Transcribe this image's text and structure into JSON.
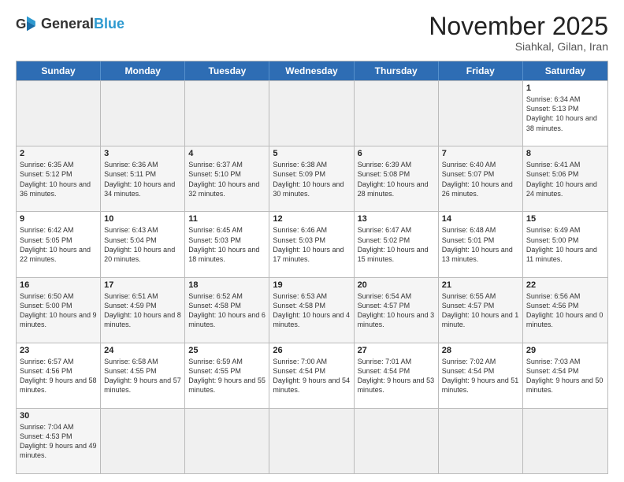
{
  "header": {
    "logo_general": "General",
    "logo_blue": "Blue",
    "month_title": "November 2025",
    "subtitle": "Siahkal, Gilan, Iran"
  },
  "days_of_week": [
    "Sunday",
    "Monday",
    "Tuesday",
    "Wednesday",
    "Thursday",
    "Friday",
    "Saturday"
  ],
  "weeks": [
    [
      {
        "day": "",
        "text": "",
        "empty": true
      },
      {
        "day": "",
        "text": "",
        "empty": true
      },
      {
        "day": "",
        "text": "",
        "empty": true
      },
      {
        "day": "",
        "text": "",
        "empty": true
      },
      {
        "day": "",
        "text": "",
        "empty": true
      },
      {
        "day": "",
        "text": "",
        "empty": true
      },
      {
        "day": "1",
        "text": "Sunrise: 6:34 AM\nSunset: 5:13 PM\nDaylight: 10 hours and 38 minutes."
      }
    ],
    [
      {
        "day": "2",
        "text": "Sunrise: 6:35 AM\nSunset: 5:12 PM\nDaylight: 10 hours and 36 minutes."
      },
      {
        "day": "3",
        "text": "Sunrise: 6:36 AM\nSunset: 5:11 PM\nDaylight: 10 hours and 34 minutes."
      },
      {
        "day": "4",
        "text": "Sunrise: 6:37 AM\nSunset: 5:10 PM\nDaylight: 10 hours and 32 minutes."
      },
      {
        "day": "5",
        "text": "Sunrise: 6:38 AM\nSunset: 5:09 PM\nDaylight: 10 hours and 30 minutes."
      },
      {
        "day": "6",
        "text": "Sunrise: 6:39 AM\nSunset: 5:08 PM\nDaylight: 10 hours and 28 minutes."
      },
      {
        "day": "7",
        "text": "Sunrise: 6:40 AM\nSunset: 5:07 PM\nDaylight: 10 hours and 26 minutes."
      },
      {
        "day": "8",
        "text": "Sunrise: 6:41 AM\nSunset: 5:06 PM\nDaylight: 10 hours and 24 minutes."
      }
    ],
    [
      {
        "day": "9",
        "text": "Sunrise: 6:42 AM\nSunset: 5:05 PM\nDaylight: 10 hours and 22 minutes."
      },
      {
        "day": "10",
        "text": "Sunrise: 6:43 AM\nSunset: 5:04 PM\nDaylight: 10 hours and 20 minutes."
      },
      {
        "day": "11",
        "text": "Sunrise: 6:45 AM\nSunset: 5:03 PM\nDaylight: 10 hours and 18 minutes."
      },
      {
        "day": "12",
        "text": "Sunrise: 6:46 AM\nSunset: 5:03 PM\nDaylight: 10 hours and 17 minutes."
      },
      {
        "day": "13",
        "text": "Sunrise: 6:47 AM\nSunset: 5:02 PM\nDaylight: 10 hours and 15 minutes."
      },
      {
        "day": "14",
        "text": "Sunrise: 6:48 AM\nSunset: 5:01 PM\nDaylight: 10 hours and 13 minutes."
      },
      {
        "day": "15",
        "text": "Sunrise: 6:49 AM\nSunset: 5:00 PM\nDaylight: 10 hours and 11 minutes."
      }
    ],
    [
      {
        "day": "16",
        "text": "Sunrise: 6:50 AM\nSunset: 5:00 PM\nDaylight: 10 hours and 9 minutes."
      },
      {
        "day": "17",
        "text": "Sunrise: 6:51 AM\nSunset: 4:59 PM\nDaylight: 10 hours and 8 minutes."
      },
      {
        "day": "18",
        "text": "Sunrise: 6:52 AM\nSunset: 4:58 PM\nDaylight: 10 hours and 6 minutes."
      },
      {
        "day": "19",
        "text": "Sunrise: 6:53 AM\nSunset: 4:58 PM\nDaylight: 10 hours and 4 minutes."
      },
      {
        "day": "20",
        "text": "Sunrise: 6:54 AM\nSunset: 4:57 PM\nDaylight: 10 hours and 3 minutes."
      },
      {
        "day": "21",
        "text": "Sunrise: 6:55 AM\nSunset: 4:57 PM\nDaylight: 10 hours and 1 minute."
      },
      {
        "day": "22",
        "text": "Sunrise: 6:56 AM\nSunset: 4:56 PM\nDaylight: 10 hours and 0 minutes."
      }
    ],
    [
      {
        "day": "23",
        "text": "Sunrise: 6:57 AM\nSunset: 4:56 PM\nDaylight: 9 hours and 58 minutes."
      },
      {
        "day": "24",
        "text": "Sunrise: 6:58 AM\nSunset: 4:55 PM\nDaylight: 9 hours and 57 minutes."
      },
      {
        "day": "25",
        "text": "Sunrise: 6:59 AM\nSunset: 4:55 PM\nDaylight: 9 hours and 55 minutes."
      },
      {
        "day": "26",
        "text": "Sunrise: 7:00 AM\nSunset: 4:54 PM\nDaylight: 9 hours and 54 minutes."
      },
      {
        "day": "27",
        "text": "Sunrise: 7:01 AM\nSunset: 4:54 PM\nDaylight: 9 hours and 53 minutes."
      },
      {
        "day": "28",
        "text": "Sunrise: 7:02 AM\nSunset: 4:54 PM\nDaylight: 9 hours and 51 minutes."
      },
      {
        "day": "29",
        "text": "Sunrise: 7:03 AM\nSunset: 4:54 PM\nDaylight: 9 hours and 50 minutes."
      }
    ],
    [
      {
        "day": "30",
        "text": "Sunrise: 7:04 AM\nSunset: 4:53 PM\nDaylight: 9 hours and 49 minutes."
      },
      {
        "day": "",
        "text": "",
        "empty": true
      },
      {
        "day": "",
        "text": "",
        "empty": true
      },
      {
        "day": "",
        "text": "",
        "empty": true
      },
      {
        "day": "",
        "text": "",
        "empty": true
      },
      {
        "day": "",
        "text": "",
        "empty": true
      },
      {
        "day": "",
        "text": "",
        "empty": true
      }
    ]
  ]
}
